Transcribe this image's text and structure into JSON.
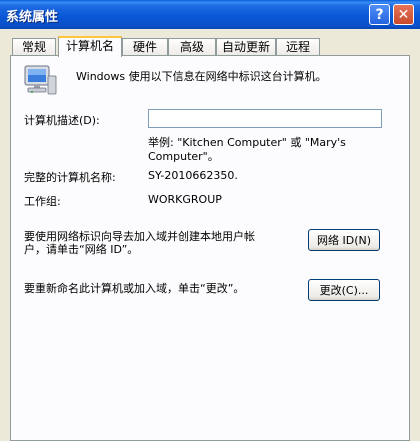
{
  "window": {
    "title": "系统属性",
    "help_label": "?",
    "close_label": "✕"
  },
  "tabs": [
    {
      "label": "常规"
    },
    {
      "label": "计算机名"
    },
    {
      "label": "硬件"
    },
    {
      "label": "高级"
    },
    {
      "label": "自动更新"
    },
    {
      "label": "远程"
    }
  ],
  "content": {
    "intro_text": "Windows 使用以下信息在网络中标识这台计算机。",
    "description_label": "计算机描述(D):",
    "description_value": "",
    "example_line1": "举例: \"Kitchen Computer\" 或 \"Mary's",
    "example_line2": "Computer\"。",
    "full_name_label": "完整的计算机名称:",
    "full_name_value": "SY-2010662350.",
    "workgroup_label": "工作组:",
    "workgroup_value": "WORKGROUP",
    "network_id_text_line1": "要使用网络标识向导去加入域并创建本地用户帐",
    "network_id_text_line2": "户，请单击“网络 ID”。",
    "network_id_button": "网络 ID(N)",
    "rename_text": "要重新命名此计算机或加入域，单击“更改”。",
    "change_button": "更改(C)..."
  },
  "icons": {
    "computer": "computer-icon"
  }
}
